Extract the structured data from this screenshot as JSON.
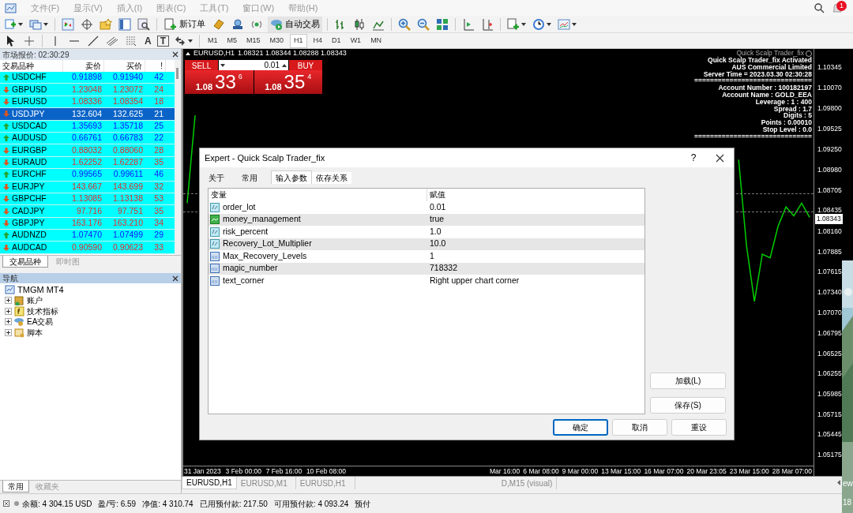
{
  "menu_bar": {
    "items": [
      "文件(F)",
      "显示(V)",
      "插入(I)",
      "图表(C)",
      "工具(T)",
      "窗口(W)",
      "帮助(H)"
    ]
  },
  "notifications": {
    "badge": "1"
  },
  "toolbar": {
    "buttons": [
      {
        "label": "新订单"
      },
      {
        "label": "自动交易"
      }
    ]
  },
  "drawing_tools": {
    "text_tools": [
      "A",
      "T"
    ]
  },
  "timeframes": [
    {
      "label": "M1",
      "selected": false
    },
    {
      "label": "M5",
      "selected": false
    },
    {
      "label": "M15",
      "selected": false
    },
    {
      "label": "M30",
      "selected": false
    },
    {
      "label": "H1",
      "selected": true
    },
    {
      "label": "H4",
      "selected": false
    },
    {
      "label": "D1",
      "selected": false
    },
    {
      "label": "W1",
      "selected": false
    },
    {
      "label": "MN",
      "selected": false
    }
  ],
  "market_watch": {
    "title": "市场报价: 02:30:29",
    "columns": [
      "交易品种",
      "卖价",
      "买价",
      "!"
    ],
    "rows": [
      {
        "symbol": "USDCHF",
        "bid": "0.91898",
        "ask": "0.91940",
        "spread": "42",
        "rising": true,
        "selected": false
      },
      {
        "symbol": "GBPUSD",
        "bid": "1.23048",
        "ask": "1.23072",
        "spread": "24",
        "rising": false,
        "selected": false
      },
      {
        "symbol": "EURUSD",
        "bid": "1.08336",
        "ask": "1.08354",
        "spread": "18",
        "rising": false,
        "selected": false
      },
      {
        "symbol": "USDJPY",
        "bid": "132.604",
        "ask": "132.625",
        "spread": "21",
        "rising": false,
        "selected": true
      },
      {
        "symbol": "USDCAD",
        "bid": "1.35693",
        "ask": "1.35718",
        "spread": "25",
        "rising": true,
        "selected": false
      },
      {
        "symbol": "AUDUSD",
        "bid": "0.66761",
        "ask": "0.66783",
        "spread": "22",
        "rising": true,
        "selected": false
      },
      {
        "symbol": "EURGBP",
        "bid": "0.88032",
        "ask": "0.88060",
        "spread": "28",
        "rising": false,
        "selected": false
      },
      {
        "symbol": "EURAUD",
        "bid": "1.62252",
        "ask": "1.62287",
        "spread": "35",
        "rising": false,
        "selected": false
      },
      {
        "symbol": "EURCHF",
        "bid": "0.99565",
        "ask": "0.99611",
        "spread": "46",
        "rising": true,
        "selected": false
      },
      {
        "symbol": "EURJPY",
        "bid": "143.667",
        "ask": "143.699",
        "spread": "32",
        "rising": false,
        "selected": false
      },
      {
        "symbol": "GBPCHF",
        "bid": "1.13085",
        "ask": "1.13138",
        "spread": "53",
        "rising": false,
        "selected": false
      },
      {
        "symbol": "CADJPY",
        "bid": "97.716",
        "ask": "97.751",
        "spread": "35",
        "rising": false,
        "selected": false
      },
      {
        "symbol": "GBPJPY",
        "bid": "163.176",
        "ask": "163.210",
        "spread": "34",
        "rising": false,
        "selected": false
      },
      {
        "symbol": "AUDNZD",
        "bid": "1.07470",
        "ask": "1.07499",
        "spread": "29",
        "rising": true,
        "selected": false
      },
      {
        "symbol": "AUDCAD",
        "bid": "0.90590",
        "ask": "0.90623",
        "spread": "33",
        "rising": false,
        "selected": false
      }
    ],
    "tabs": [
      {
        "label": "交易品种",
        "selected": true
      },
      {
        "label": "即时图",
        "selected": false
      }
    ]
  },
  "navigator": {
    "title": "导航",
    "root": {
      "label": "TMGM MT4",
      "children": [
        {
          "label": "账户",
          "expanded": false
        },
        {
          "label": "技术指标",
          "expanded": false
        },
        {
          "label": "EA交易",
          "expanded": false
        },
        {
          "label": "脚本",
          "expanded": false
        }
      ]
    },
    "tabs": [
      {
        "label": "常用",
        "selected": true
      },
      {
        "label": "收藏夹",
        "selected": false
      }
    ]
  },
  "chart": {
    "symbol": "EURUSD,H1",
    "ohlc": "1.08321 1.08344 1.08288 1.08343",
    "trade_panel": {
      "sell_label": "SELL",
      "buy_label": "BUY",
      "lot": "0.01",
      "sell_price": {
        "big": "1.08",
        "pips": "33",
        "fraction": "6"
      },
      "buy_price": {
        "big": "1.08",
        "pips": "35",
        "fraction": "4"
      }
    },
    "expert_name": "Quick Scalp Trader_fix",
    "info_lines": [
      "Quick Scalp Trader_fix Activated",
      "AUS Commercial Limited",
      "Server Time = 2023.03.30 02:30:28",
      "==============================",
      "Account Number : 100182197",
      "Account Name : GOLD_EEA",
      "Leverage : 1 : 400",
      "Spread : 1.7",
      "Digits : 5",
      "Points : 0.00010",
      "Stop Level : 0.0",
      "=============================="
    ],
    "chart_data": {
      "type": "line",
      "categories": [
        null,
        null,
        null,
        null,
        null,
        null,
        null,
        null,
        null,
        null,
        null,
        null,
        null,
        null,
        null,
        null,
        null,
        null,
        null,
        null,
        null,
        null,
        null,
        null,
        null,
        null,
        null,
        null,
        null,
        null,
        null,
        null,
        null,
        null,
        null,
        null,
        null,
        null,
        null,
        null,
        null,
        null,
        null,
        null,
        null,
        null,
        null,
        null,
        null,
        null,
        null,
        null,
        null,
        null,
        null,
        null,
        null,
        null,
        null,
        null,
        null,
        null,
        null,
        null,
        null,
        null,
        null,
        null,
        null,
        null,
        null,
        null,
        null,
        null,
        null,
        null,
        null,
        null,
        null,
        null
      ],
      "ylim": [
        1.05028,
        1.10587
      ],
      "series": [
        {
          "color": "#00d000",
          "values": [
            1.0853,
            1.097,
            null,
            null,
            null,
            null,
            null,
            null,
            null,
            null,
            null,
            null,
            null,
            null,
            null,
            null,
            null,
            null,
            null,
            null,
            null,
            null,
            null,
            null,
            null,
            null,
            null,
            null,
            null,
            null,
            null,
            null,
            null,
            null,
            null,
            null,
            null,
            null,
            null,
            null,
            null,
            null,
            null,
            null,
            null,
            null,
            null,
            null,
            null,
            null,
            null,
            null,
            null,
            null,
            null,
            null,
            null,
            null,
            null,
            null,
            null,
            null,
            null,
            null,
            null,
            null,
            null,
            null,
            null,
            null,
            1.0911,
            1.0796,
            1.0722,
            1.0785,
            1.078,
            1.0822,
            1.0848,
            1.0836,
            1.0853,
            1.0834
          ]
        }
      ],
      "yticks": [
        {
          "value": 1.10345,
          "label": "1.10345"
        },
        {
          "value": 1.1007,
          "label": "1.10070"
        },
        {
          "value": 1.098,
          "label": "1.09800"
        },
        {
          "value": 1.09525,
          "label": "1.09525"
        },
        {
          "value": 1.0925,
          "label": "1.09250"
        },
        {
          "value": 1.0898,
          "label": "1.08980"
        },
        {
          "value": 1.08705,
          "label": "1.08705"
        },
        {
          "value": 1.08435,
          "label": "1.08435"
        },
        {
          "value": 1.0816,
          "label": "1.08160"
        },
        {
          "value": 1.07885,
          "label": "1.07885"
        },
        {
          "value": 1.07615,
          "label": "1.07615"
        },
        {
          "value": 1.0734,
          "label": "1.07340"
        },
        {
          "value": 1.0707,
          "label": "1.07070"
        },
        {
          "value": 1.06795,
          "label": "1.06795"
        },
        {
          "value": 1.06525,
          "label": "1.06525"
        },
        {
          "value": 1.06255,
          "label": "1.06255"
        },
        {
          "value": 1.05985,
          "label": "1.05985"
        },
        {
          "value": 1.05715,
          "label": "1.05715"
        },
        {
          "value": 1.05445,
          "label": "1.05445"
        },
        {
          "value": 1.05175,
          "label": "1.05175"
        }
      ]
    },
    "current_price": "1.08343",
    "time_axis_left": [
      "31 Jan 2023",
      "3 Feb 00:00",
      "7 Feb 16:00",
      "10 Feb 08:00"
    ],
    "time_axis_right": [
      "Mar 16:00",
      "6 Mar 08:00",
      "9 Mar 00:00",
      "13 Mar 15:00",
      "16 Mar 07:00",
      "20 Mar 23:05",
      "23 Mar 15:00",
      "28 Mar 07:00"
    ],
    "tabs": [
      {
        "label": "EURUSD,H1",
        "selected": true
      },
      {
        "label": "EURUSD,M1",
        "selected": false
      },
      {
        "label": "EURUSD,H1",
        "selected": false
      },
      {
        "label": "D,M15 (visual)",
        "selected": false
      }
    ]
  },
  "dialog": {
    "title": "Expert - Quick Scalp Trader_fix",
    "help": "?",
    "tabs": [
      {
        "label": "关于",
        "selected": false
      },
      {
        "label": "常用",
        "selected": false
      },
      {
        "label": "输入参数",
        "selected": true
      },
      {
        "label": "依存关系",
        "selected": false
      }
    ],
    "columns": [
      "变量",
      "赋值"
    ],
    "params": [
      {
        "name": "order_lot",
        "value": "0.01",
        "kind": "double"
      },
      {
        "name": "money_management",
        "value": "true",
        "kind": "bool"
      },
      {
        "name": "risk_percent",
        "value": "1.0",
        "kind": "double"
      },
      {
        "name": "Recovery_Lot_Multiplier",
        "value": "10.0",
        "kind": "double"
      },
      {
        "name": "Max_Recovery_Levels",
        "value": "1",
        "kind": "int"
      },
      {
        "name": "magic_number",
        "value": "718332",
        "kind": "int"
      },
      {
        "name": "text_corner",
        "value": "Right upper chart corner",
        "kind": "int"
      }
    ],
    "side_buttons": [
      "加载(L)",
      "保存(S)"
    ],
    "buttons": [
      {
        "label": "确定",
        "default": true
      },
      {
        "label": "取消",
        "default": false
      },
      {
        "label": "重设",
        "default": false
      }
    ]
  },
  "status_bar": {
    "items": [
      "余额: 4 304.15 USD",
      "盈/亏: 6.59",
      "净值: 4 310.74",
      "已用预付款: 217.50",
      "可用预付款: 4 093.24",
      "预付"
    ]
  },
  "desktop": {
    "texts": [
      "ew",
      "18"
    ]
  }
}
